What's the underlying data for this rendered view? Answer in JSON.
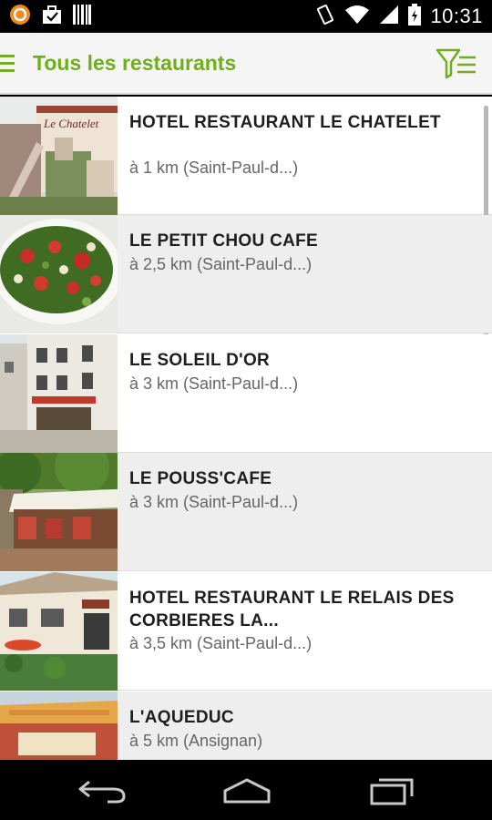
{
  "status_bar": {
    "time": "10:31",
    "left_icons": [
      "notification-circle-icon",
      "briefcase-icon",
      "barcode-icon"
    ],
    "right_icons": [
      "vibrate-icon",
      "wifi-icon",
      "signal-icon",
      "battery-icon"
    ]
  },
  "app_bar": {
    "title": "Tous les restaurants",
    "menu_icon": "hamburger-icon",
    "filter_icon": "filter-list-icon",
    "accent_color": "#6fae1c"
  },
  "restaurants": [
    {
      "name": "HOTEL RESTAURANT LE CHATELET",
      "distance": "à 1 km (Saint-Paul-d...)"
    },
    {
      "name": "LE PETIT CHOU CAFE",
      "distance": "à 2,5 km (Saint-Paul-d...)"
    },
    {
      "name": "LE SOLEIL D'OR",
      "distance": "à 3 km (Saint-Paul-d...)"
    },
    {
      "name": "LE POUSS'CAFE",
      "distance": "à 3 km (Saint-Paul-d...)"
    },
    {
      "name": "HOTEL RESTAURANT LE RELAIS DES CORBIERES LA...",
      "distance": "à 3,5 km (Saint-Paul-d...)"
    },
    {
      "name": "L'AQUEDUC",
      "distance": "à 5 km (Ansignan)"
    }
  ],
  "thumb_logo_text": "Le Chatelet",
  "nav_bar": {
    "icons": [
      "back-icon",
      "home-icon",
      "recent-apps-icon"
    ]
  }
}
